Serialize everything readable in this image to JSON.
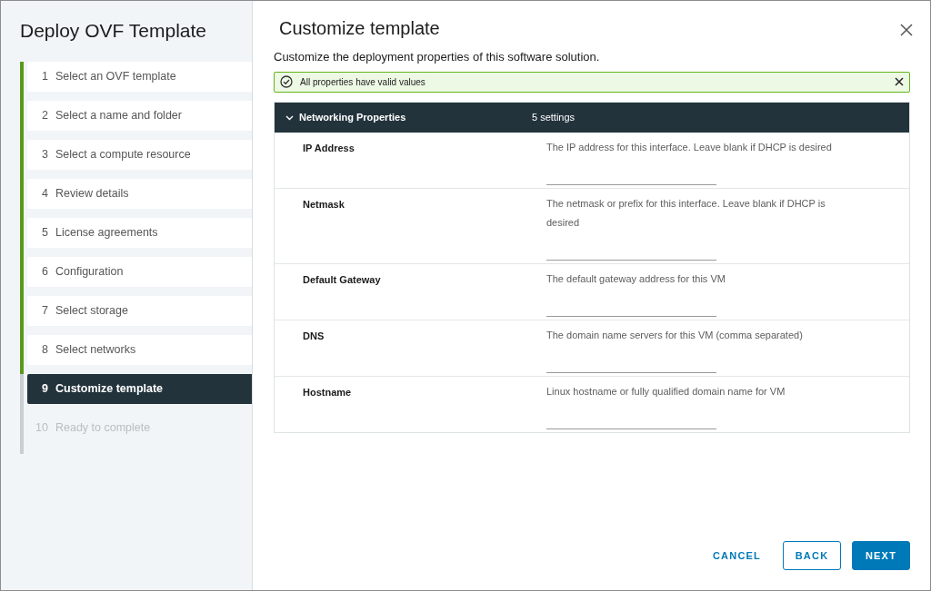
{
  "wizard": {
    "title": "Deploy OVF Template",
    "steps": [
      {
        "number": "1",
        "label": "Select an OVF template",
        "completed": true,
        "selected": false,
        "disabled": false
      },
      {
        "number": "2",
        "label": "Select a name and folder",
        "completed": true,
        "selected": false,
        "disabled": false
      },
      {
        "number": "3",
        "label": "Select a compute resource",
        "completed": true,
        "selected": false,
        "disabled": false
      },
      {
        "number": "4",
        "label": "Review details",
        "completed": true,
        "selected": false,
        "disabled": false
      },
      {
        "number": "5",
        "label": "License agreements",
        "completed": true,
        "selected": false,
        "disabled": false
      },
      {
        "number": "6",
        "label": "Configuration",
        "completed": true,
        "selected": false,
        "disabled": false
      },
      {
        "number": "7",
        "label": "Select storage",
        "completed": true,
        "selected": false,
        "disabled": false
      },
      {
        "number": "8",
        "label": "Select networks",
        "completed": true,
        "selected": false,
        "disabled": false
      },
      {
        "number": "9",
        "label": "Customize template",
        "completed": false,
        "selected": true,
        "disabled": false
      },
      {
        "number": "10",
        "label": "Ready to complete",
        "completed": false,
        "selected": false,
        "disabled": true
      }
    ]
  },
  "page": {
    "title": "Customize template",
    "description": "Customize the deployment properties of this software solution.",
    "alert": {
      "text": "All properties have valid values"
    },
    "group": {
      "title": "Networking Properties",
      "count": "5 settings",
      "expanded": true,
      "properties": [
        {
          "label": "IP Address",
          "description": "The IP address for this interface. Leave blank if DHCP is desired"
        },
        {
          "label": "Netmask",
          "description": "The netmask or prefix for this interface. Leave blank if DHCP is desired"
        },
        {
          "label": "Default Gateway",
          "description": "The default gateway address for this VM"
        },
        {
          "label": "DNS",
          "description": "The domain name servers for this VM (comma separated)"
        },
        {
          "label": "Hostname",
          "description": "Linux hostname or fully qualified domain name for VM"
        }
      ]
    }
  },
  "buttons": [
    {
      "kind": "flat",
      "label": "CANCEL"
    },
    {
      "kind": "outline",
      "label": "BACK"
    },
    {
      "kind": "primary",
      "label": "NEXT"
    }
  ]
}
